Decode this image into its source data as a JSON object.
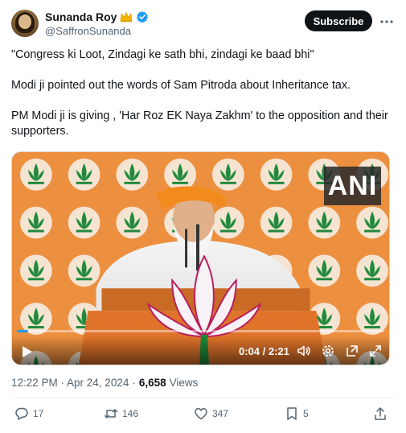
{
  "author": {
    "display_name": "Sunanda Roy",
    "handle": "@SaffronSunanda",
    "badges": [
      "crown-icon",
      "verified-icon"
    ]
  },
  "subscribe_label": "Subscribe",
  "tweet_text": [
    "\"Congress ki Loot, Zindagi ke sath bhi, zindagi ke baad bhi\"",
    "Modi ji pointed out the words of Sam Pitroda about Inheritance tax.",
    "PM Modi ji is giving , 'Har Roz EK Naya Zakhm' to the opposition and their supporters."
  ],
  "video": {
    "watermark": "ANI",
    "time_label": "0:04 / 2:21",
    "progress": 0.03,
    "controls": [
      "play-icon",
      "volume-icon",
      "settings-icon",
      "pip-icon",
      "fullscreen-icon"
    ]
  },
  "meta": {
    "timestamp": "12:22 PM · Apr 24, 2024",
    "separator": "·",
    "views_count": "6,658",
    "views_label": "Views"
  },
  "actions": {
    "replies": "17",
    "reposts": "146",
    "likes": "347",
    "bookmarks": "5"
  },
  "colors": {
    "accent": "#1d9bf0",
    "text": "#0f1419",
    "secondary": "#536471",
    "crown": "#f4b400",
    "stage_orange": "#e98a3a"
  }
}
